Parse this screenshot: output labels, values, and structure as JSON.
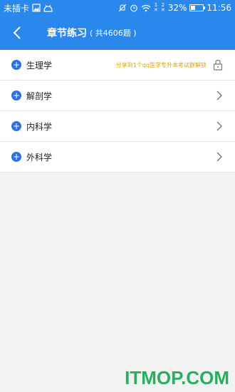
{
  "status_bar": {
    "carrier": "未插卡",
    "sim1": "1",
    "sim2": "2",
    "battery_pct": "32%",
    "battery_level": 0.32,
    "time": "11:56",
    "icons": [
      "image-icon",
      "android-icon",
      "silent-icon",
      "alarm-icon",
      "wifi-icon",
      "signal-icon"
    ]
  },
  "nav": {
    "title": "章节练习",
    "count": "( 共4606题 )"
  },
  "rows": [
    {
      "label": "生理学",
      "note": "分享到1个qq医学专升本考试群解锁",
      "locked": true
    },
    {
      "label": "解剖学",
      "locked": false
    },
    {
      "label": "内科学",
      "locked": false
    },
    {
      "label": "外科学",
      "locked": false
    }
  ],
  "watermark": "ITMOP.COM",
  "colors": {
    "primary": "#2a87eb",
    "plus": "#2f6fe0",
    "note": "#e6a300",
    "watermark": "#27ae60"
  }
}
